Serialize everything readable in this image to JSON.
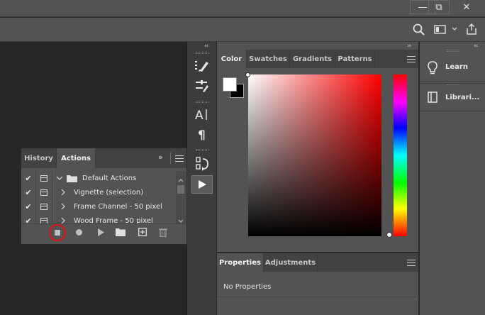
{
  "window": {
    "minimize": "—",
    "restore": "⧉",
    "close": "✕"
  },
  "toolbar_collapse": "‹‹",
  "panels_collapse": "››",
  "right_collapse": "‹‹",
  "color_panel": {
    "tabs": [
      "Color",
      "Swatches",
      "Gradients",
      "Patterns"
    ],
    "active_tab": "Color",
    "foreground": "#ffffff",
    "background": "#000000"
  },
  "properties_panel": {
    "tabs": [
      "Properties",
      "Adjustments"
    ],
    "active_tab": "Properties",
    "empty_text": "No Properties"
  },
  "right_panel": {
    "items": [
      {
        "label": "Learn",
        "icon": "lightbulb-icon"
      },
      {
        "label": "Librari...",
        "icon": "libraries-icon"
      }
    ]
  },
  "actions_panel": {
    "tabs": [
      "History",
      "Actions"
    ],
    "active_tab": "Actions",
    "collapse": "››",
    "rows": [
      {
        "checked": "✔",
        "label": "Default Actions",
        "type": "set"
      },
      {
        "checked": "✔",
        "label": "Vignette (selection)",
        "type": "action"
      },
      {
        "checked": "✔",
        "label": "Frame Channel - 50 pixel",
        "type": "action"
      },
      {
        "checked": "✔",
        "label": "Wood Frame - 50 pixel",
        "type": "action"
      }
    ],
    "footer_buttons": [
      "stop",
      "record",
      "play",
      "new-set",
      "new-action",
      "delete"
    ],
    "highlighted_button": "stop"
  },
  "tool_icons": [
    "brush-settings-icon",
    "adjustments-icon",
    "character-icon",
    "paragraph-icon",
    "actions-history-icon",
    "play-icon"
  ]
}
